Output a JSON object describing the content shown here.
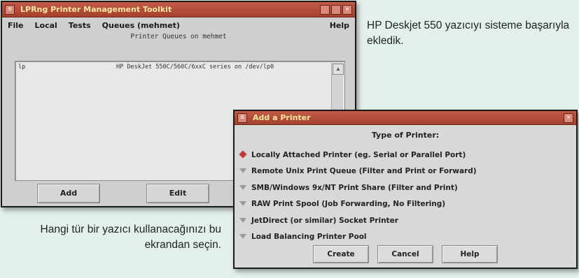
{
  "caption_top": "HP Deskjet 550 yazıcıyı sisteme başarıyla ekledik.",
  "caption_bottom": "Hangi tür bir yazıcı kullanacağınızı bu ekrandan seçin.",
  "main_window": {
    "title": "LPRng Printer Management Toolkit",
    "menu": [
      "File",
      "Local",
      "Tests",
      "Queues (mehmet)"
    ],
    "help": "Help",
    "queue_header": "Printer Queues on mehmet",
    "rows": [
      {
        "name": "lp",
        "description": "HP DeskJet 550C/560C/6xxC series on /dev/lp0"
      }
    ],
    "buttons": {
      "add": "Add",
      "edit": "Edit"
    }
  },
  "dialog": {
    "title": "Add a Printer",
    "heading": "Type of Printer:",
    "options": [
      "Locally Attached Printer (eg. Serial or Parallel Port)",
      "Remote Unix Print Queue (Filter and Print or Forward)",
      "SMB/Windows 9x/NT Print Share (Filter and Print)",
      "RAW Print Spool (Job Forwarding, No Filtering)",
      "JetDirect (or similar) Socket Printer",
      "Load Balancing Printer Pool"
    ],
    "selected_index": 0,
    "buttons": {
      "create": "Create",
      "cancel": "Cancel",
      "help": "Help"
    }
  },
  "colors": {
    "titlebar": "#b24c39",
    "title_text": "#f5e7a0",
    "selected_radio": "#c03a3a",
    "background": "#e3efe9"
  }
}
